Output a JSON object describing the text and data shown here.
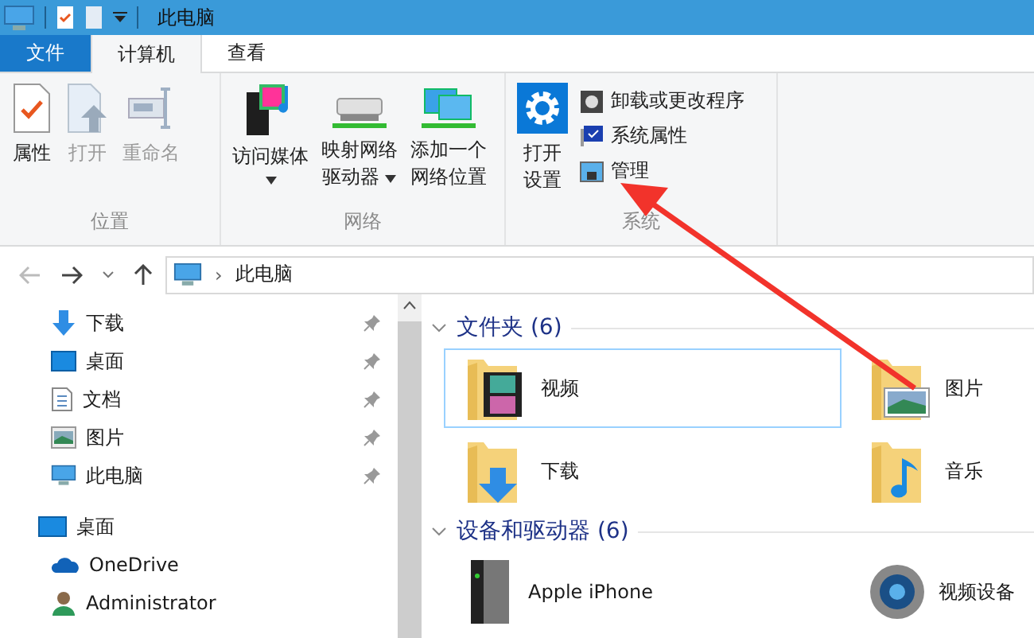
{
  "window": {
    "title": "此电脑"
  },
  "tabs": [
    {
      "label": "文件",
      "kind": "file",
      "selected": false
    },
    {
      "label": "计算机",
      "kind": "tab",
      "selected": true
    },
    {
      "label": "查看",
      "kind": "tab",
      "selected": false
    }
  ],
  "ribbon": {
    "groups": [
      {
        "name": "位置",
        "buttons": [
          {
            "label": [
              "属性"
            ],
            "disabled": false,
            "menu": false
          },
          {
            "label": [
              "打开"
            ],
            "disabled": true,
            "menu": false
          },
          {
            "label": [
              "重命名"
            ],
            "disabled": true,
            "menu": false
          }
        ]
      },
      {
        "name": "网络",
        "buttons": [
          {
            "label": [
              "访问媒体"
            ],
            "disabled": false,
            "menu": true
          },
          {
            "label": [
              "映射网络",
              "驱动器"
            ],
            "disabled": false,
            "menu": true
          },
          {
            "label": [
              "添加一个",
              "网络位置"
            ],
            "disabled": false,
            "menu": false
          }
        ]
      },
      {
        "name": "系统",
        "buttons": [
          {
            "label": [
              "打开",
              "设置"
            ],
            "disabled": false,
            "menu": false
          }
        ],
        "small_buttons": [
          "卸载或更改程序",
          "系统属性",
          "管理"
        ]
      }
    ]
  },
  "address": {
    "path": "此电脑",
    "separator": "›"
  },
  "sidebar": {
    "quick_access": [
      {
        "label": "下载",
        "pinned": true
      },
      {
        "label": "桌面",
        "pinned": true
      },
      {
        "label": "文档",
        "pinned": true
      },
      {
        "label": "图片",
        "pinned": true
      },
      {
        "label": "此电脑",
        "pinned": true
      }
    ],
    "items": [
      {
        "label": "桌面",
        "children": [
          {
            "label": "OneDrive"
          },
          {
            "label": "Administrator"
          }
        ]
      }
    ]
  },
  "sections": [
    {
      "title": "文件夹 (6)",
      "expanded": true,
      "items": [
        {
          "label": "视频",
          "selected": true
        },
        {
          "label": "图片",
          "selected": false
        },
        {
          "label": "下载",
          "selected": false
        },
        {
          "label": "音乐",
          "selected": false
        }
      ]
    },
    {
      "title": "设备和驱动器 (6)",
      "expanded": true,
      "items": [
        {
          "label": "Apple iPhone",
          "selected": false
        },
        {
          "label": "视频设备",
          "selected": false
        }
      ]
    }
  ]
}
